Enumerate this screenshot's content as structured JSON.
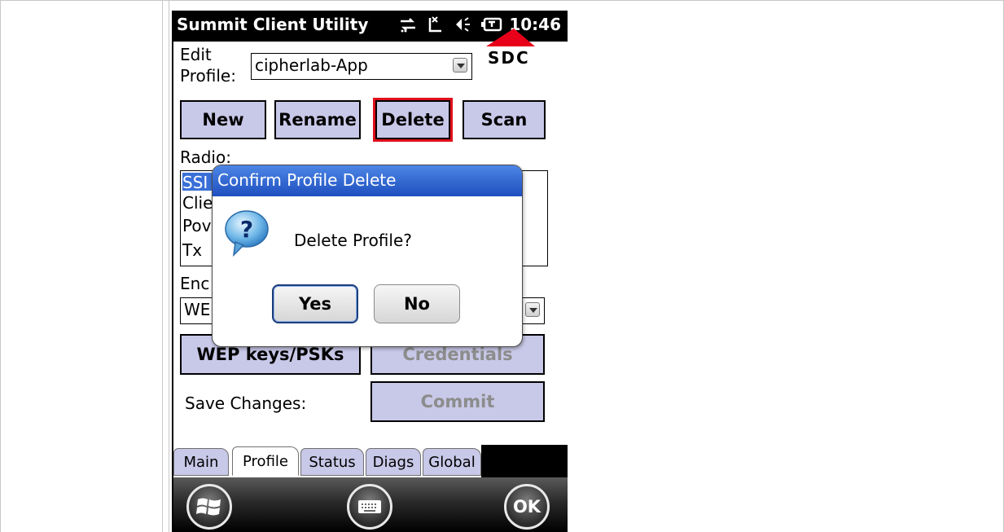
{
  "app": {
    "title": "Summit Client Utility",
    "time": "10:46",
    "status_icons": [
      "sync-icon",
      "signal-icon",
      "speaker-icon",
      "battery-icon"
    ]
  },
  "profile": {
    "edit_label_line1": "Edit",
    "edit_label_line2": "Profile:",
    "selected": "cipherlab-App",
    "logo_text": "SDC"
  },
  "actions": {
    "new": "New",
    "rename": "Rename",
    "delete": "Delete",
    "scan": "Scan"
  },
  "radio": {
    "label": "Radio:",
    "items": [
      "SSI",
      "Clie",
      "Pov",
      "Tx"
    ]
  },
  "encryption": {
    "label": "Enc",
    "value": "WE"
  },
  "buttons": {
    "wep_keys": "WEP keys/PSKs",
    "credentials": "Credentials",
    "commit": "Commit"
  },
  "save_changes_label": "Save Changes:",
  "tabs": [
    "Main",
    "Profile",
    "Status",
    "Diags",
    "Global"
  ],
  "active_tab": "Profile",
  "softkeys": {
    "ok": "OK"
  },
  "dialog": {
    "title": "Confirm Profile Delete",
    "message": "Delete Profile?",
    "yes": "Yes",
    "no": "No"
  },
  "colors": {
    "button_fill": "#c8c8e8",
    "delete_highlight": "#e0101c",
    "dialog_title": "#2a5dd0",
    "logo_red": "#e8001a"
  }
}
